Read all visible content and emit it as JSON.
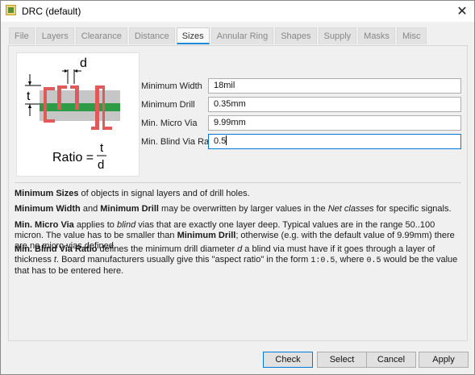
{
  "window": {
    "title": "DRC (default)",
    "close_glyph": "✕"
  },
  "tabs": [
    {
      "label": "File",
      "active": false
    },
    {
      "label": "Layers",
      "active": false
    },
    {
      "label": "Clearance",
      "active": false
    },
    {
      "label": "Distance",
      "active": false
    },
    {
      "label": "Sizes",
      "active": true
    },
    {
      "label": "Annular Ring",
      "active": false
    },
    {
      "label": "Shapes",
      "active": false
    },
    {
      "label": "Supply",
      "active": false
    },
    {
      "label": "Masks",
      "active": false
    },
    {
      "label": "Misc",
      "active": false
    }
  ],
  "diagram": {
    "d_label": "d",
    "t_label": "t",
    "ratio_label": "Ratio =",
    "ratio_num": "t",
    "ratio_den": "d",
    "colors": {
      "copper": "#e05a5a",
      "substrate": "#c6c6c6",
      "inner": "#2e9c46"
    }
  },
  "fields": {
    "min_width": {
      "label": "Minimum Width",
      "value": "18mil"
    },
    "min_drill": {
      "label": "Minimum Drill",
      "value": "0.35mm"
    },
    "min_micro_via": {
      "label": "Min. Micro Via",
      "value": "9.99mm"
    },
    "min_blind_via_ratio": {
      "label": "Min. Blind Via Ratio",
      "value": "0.5"
    }
  },
  "help": {
    "p1_b": "Minimum Sizes",
    "p1_t": " of objects in signal layers and of drill holes.",
    "p2_b1": "Minimum Width",
    "p2_t1": " and ",
    "p2_b2": "Minimum Drill",
    "p2_t2": " may be overwritten by larger values in the ",
    "p2_i": "Net classes",
    "p2_t3": " for specific signals.",
    "p3_b1": "Min. Micro Via",
    "p3_t1": " applies to ",
    "p3_i": "blind",
    "p3_t2": " vias that are exactly one layer deep. Typical values are in the range 50..100 micron. The value has to be smaller than ",
    "p3_b2": "Minimum Drill",
    "p3_t3": "; otherwise (e.g. with the default value of 9.99mm) there are no micro vias defined.",
    "p4_b": "Min. Blind Via Ratio",
    "p4_t1": " defines the minimum drill diameter ",
    "p4_i1": "d",
    "p4_t2": " a blind via must have if it goes through a layer of thickness ",
    "p4_i2": "t",
    "p4_t3": ". Board manufacturers usually give this \"aspect ratio\" in the form ",
    "p4_m1": "1:0.5",
    "p4_t4": ", where ",
    "p4_m2": "0.5",
    "p4_t5": " would be the value that has to be entered here."
  },
  "buttons": {
    "check": "Check",
    "select": "Select",
    "cancel": "Cancel",
    "apply": "Apply"
  },
  "colors": {
    "accent": "#0078d7",
    "tab_underline": "#1f8ad8"
  }
}
